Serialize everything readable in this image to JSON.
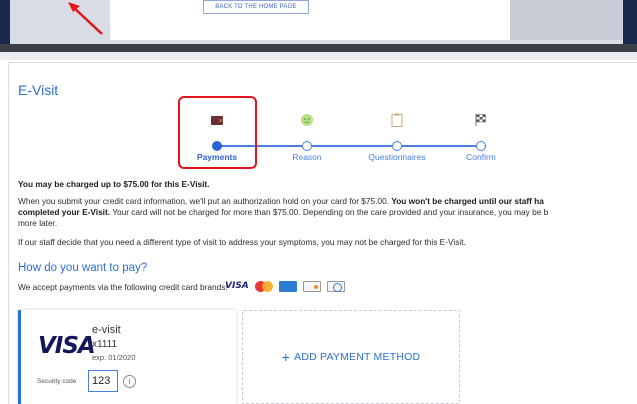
{
  "top": {
    "home_button": "BACK TO THE HOME PAGE"
  },
  "page": {
    "title": "E-Visit"
  },
  "stepper": {
    "steps": [
      {
        "label": "Payments",
        "icon": "wallet-icon",
        "active": true
      },
      {
        "label": "Reason",
        "icon": "face-icon",
        "active": false
      },
      {
        "label": "Questionnaires",
        "icon": "clipboard-icon",
        "active": false
      },
      {
        "label": "Confirm",
        "icon": "checkered-flag-icon",
        "active": false
      }
    ]
  },
  "notice": {
    "charged_line": "You may be charged up to $75.00 for this E-Visit.",
    "para1_a": "When you submit your credit card information, we'll put an authorization hold on your card for $75.00. ",
    "para1_a_bold": "You won't be charged until our staff ha",
    "para1_b_bold": "completed your E-Visit.",
    "para1_b": " Your card will not be charged for more than $75.00. Depending on the care provided and your insurance, you may be b",
    "para1_c": "more later.",
    "para2": "If our staff decide that you need a different type of visit to address your symptoms, you may not be charged for this E-Visit."
  },
  "payment": {
    "heading": "How do you want to pay?",
    "accept_text": "We accept payments via the following credit card brands:",
    "brands": [
      "VISA",
      "mastercard-icon",
      "amex-icon",
      "discover-icon",
      "diners-icon"
    ],
    "card": {
      "brand": "VISA",
      "name": "e-visit",
      "number": "x1111",
      "expiry": "exp. 01/2020",
      "security_label": "Security code",
      "security_value": "123"
    },
    "add_method": "ADD PAYMENT METHOD"
  },
  "colors": {
    "accent": "#2a6fd6",
    "highlight": "#e3141c"
  }
}
